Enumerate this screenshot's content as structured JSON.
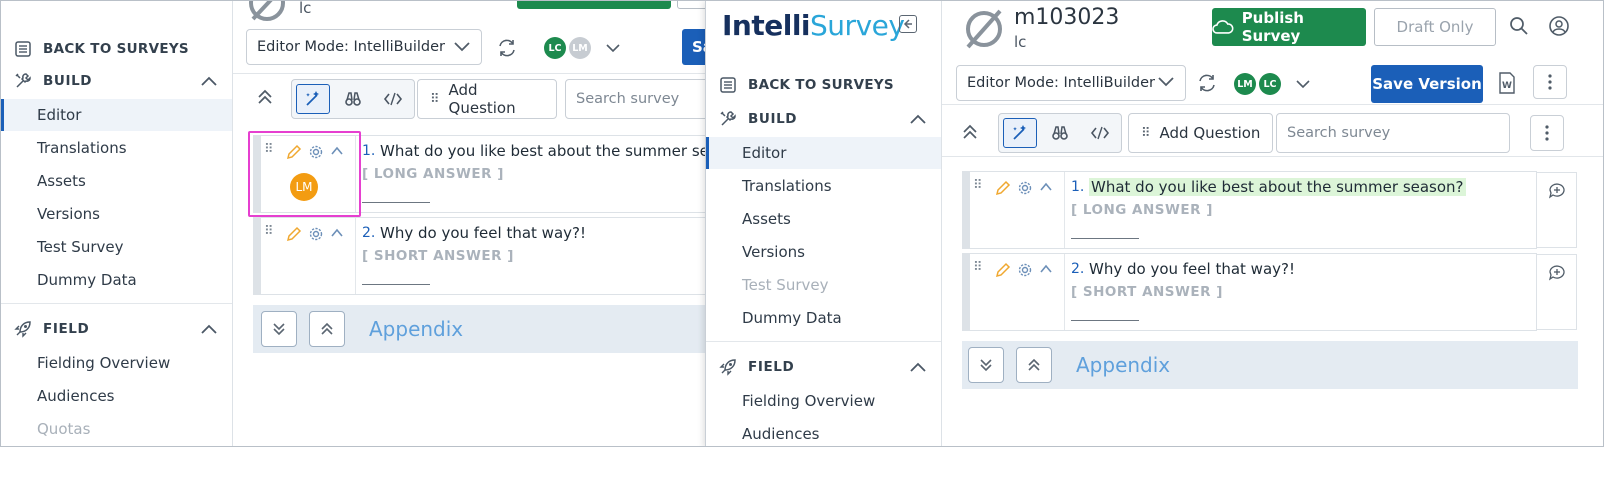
{
  "app": {
    "logo_part1": "Intelli",
    "logo_part2": "Survey",
    "colors": {
      "primary": "#1b5fb8",
      "publish": "#1d8a4e",
      "appendix": "#5fa0dc",
      "highlight": "#e63fd0",
      "avatar_lm": "#f39c12",
      "avatar_lc": "#1d8a4e"
    }
  },
  "survey": {
    "id": "m103023",
    "subtitle": "lc",
    "publish_label": "Publish Survey",
    "draft_label": "Draft Only",
    "save_label": "Save Version",
    "save_label_cut": "Sa"
  },
  "sidebar": {
    "back_label": "BACK TO SURVEYS",
    "build_section": "BUILD",
    "build_items": [
      "Editor",
      "Translations",
      "Assets",
      "Versions",
      "Test Survey",
      "Dummy Data"
    ],
    "field_section": "FIELD",
    "field_items": [
      "Fielding Overview",
      "Audiences",
      "Quotas"
    ]
  },
  "editor": {
    "mode_label": "Editor Mode: IntelliBuilder",
    "avatars": [
      "LM",
      "LC"
    ],
    "avatars_left": [
      "LC",
      "LM"
    ],
    "add_question_label": "Add Question",
    "search_placeholder": "Search survey",
    "presence_avatar": "LM"
  },
  "questions": [
    {
      "number": "1.",
      "text": "What do you like best about the summer season?",
      "text_cut": "What do you like best about the summer seas",
      "type": "[ LONG ANSWER ]"
    },
    {
      "number": "2.",
      "text": "Why do you feel that way?!",
      "type": "[ SHORT ANSWER ]"
    }
  ],
  "appendix": {
    "label": "Appendix"
  }
}
